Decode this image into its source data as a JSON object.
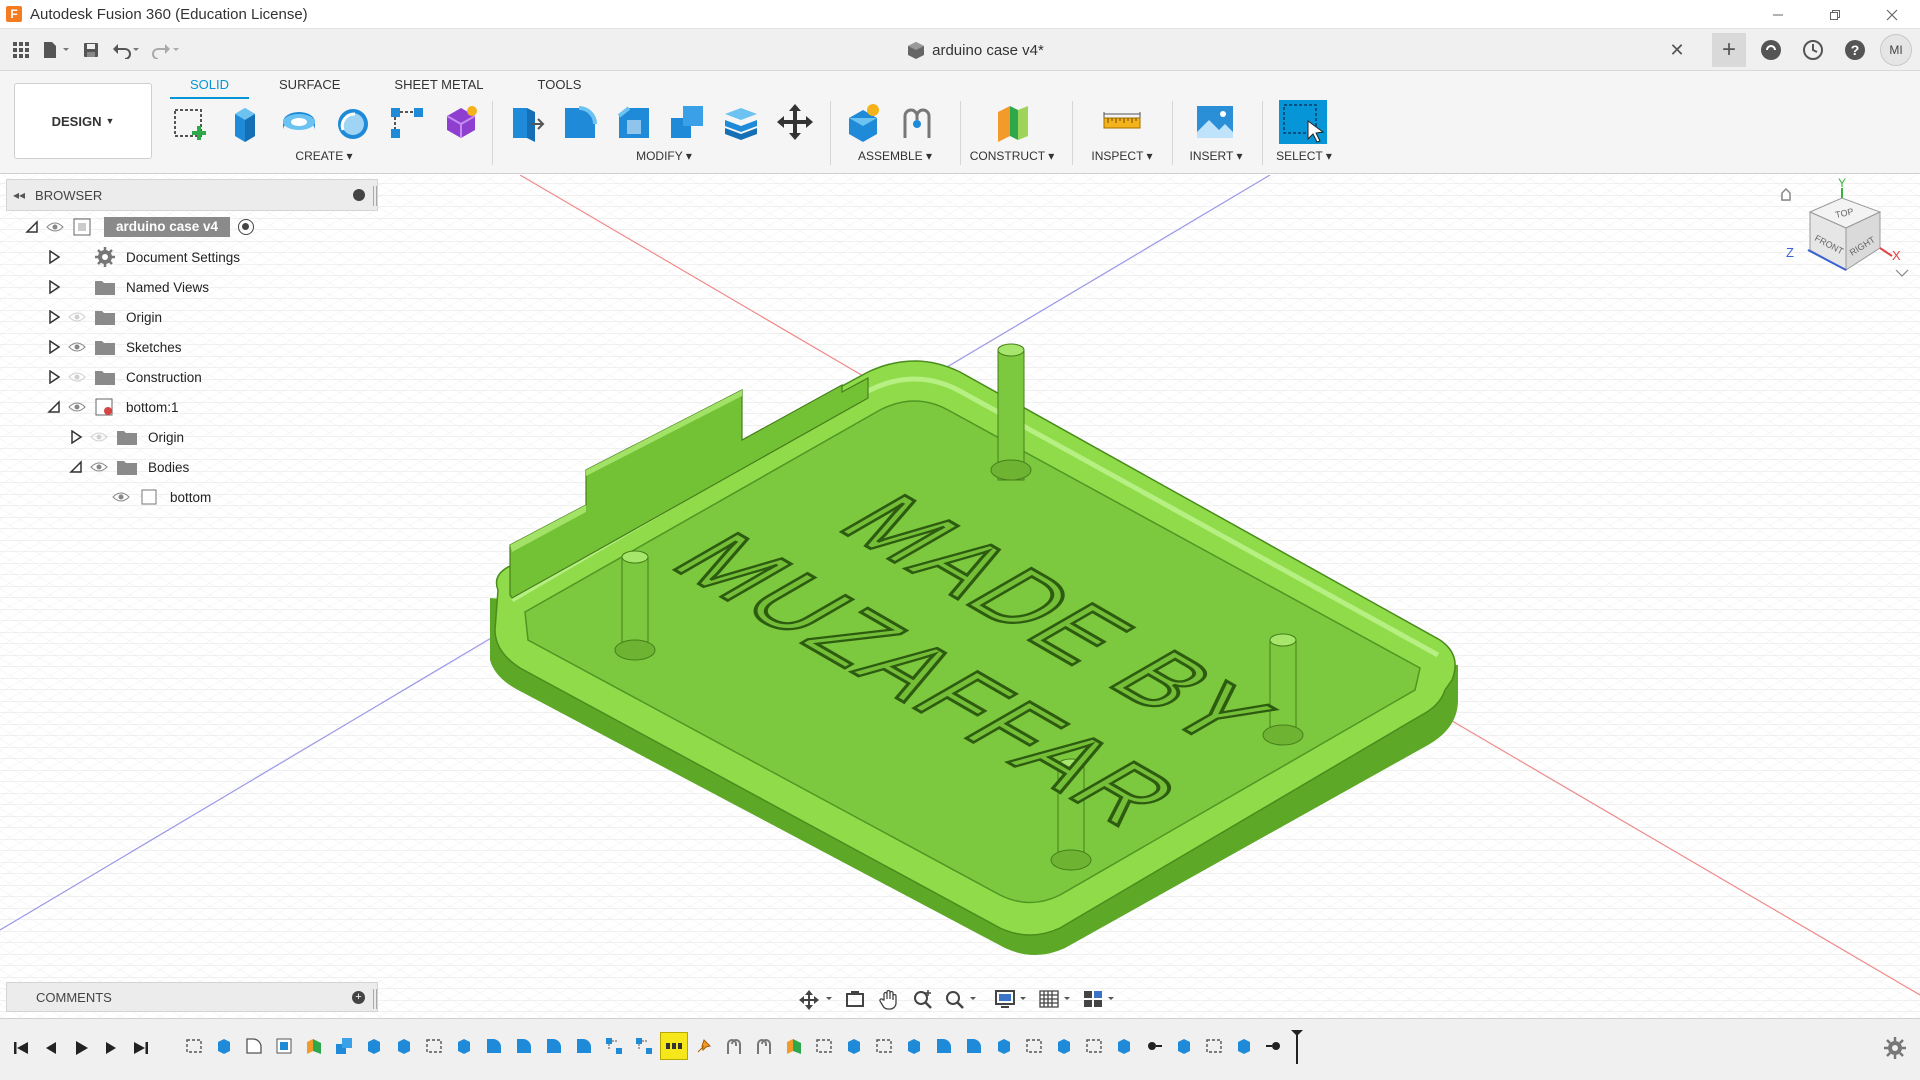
{
  "window": {
    "title": "Autodesk Fusion 360 (Education License)",
    "minimize_icon": "minimize-icon",
    "restore_icon": "restore-icon",
    "close_icon": "close-icon"
  },
  "tabbar": {
    "document_title": "arduino case v4*",
    "user_initials": "MI"
  },
  "toolbar": {
    "design_label": "DESIGN",
    "workspace_tabs": [
      "SOLID",
      "SURFACE",
      "SHEET METAL",
      "TOOLS"
    ],
    "active_tab": "SOLID",
    "groups": {
      "create": "CREATE",
      "modify": "MODIFY",
      "assemble": "ASSEMBLE",
      "construct": "CONSTRUCT",
      "inspect": "INSPECT",
      "insert": "INSERT",
      "select": "SELECT"
    }
  },
  "browser": {
    "title": "BROWSER",
    "items": [
      {
        "label": "arduino case v4",
        "level": 0,
        "expanded": true,
        "icon": "component-icon"
      },
      {
        "label": "Document Settings",
        "level": 1,
        "expanded": false,
        "icon": "gear-icon"
      },
      {
        "label": "Named Views",
        "level": 1,
        "expanded": false,
        "icon": "folder-icon"
      },
      {
        "label": "Origin",
        "level": 1,
        "expanded": false,
        "icon": "folder-icon"
      },
      {
        "label": "Sketches",
        "level": 1,
        "expanded": false,
        "icon": "folder-icon"
      },
      {
        "label": "Construction",
        "level": 1,
        "expanded": false,
        "icon": "folder-icon"
      },
      {
        "label": "bottom:1",
        "level": 1,
        "expanded": true,
        "icon": "component-icon"
      },
      {
        "label": "Origin",
        "level": 2,
        "expanded": false,
        "icon": "folder-icon"
      },
      {
        "label": "Bodies",
        "level": 2,
        "expanded": true,
        "icon": "folder-icon"
      },
      {
        "label": "bottom",
        "level": 3,
        "icon": "body-icon"
      }
    ]
  },
  "comments": {
    "title": "COMMENTS"
  },
  "model": {
    "engraved_text_line1": "MADE BY",
    "engraved_text_line2": "MUZAFFAR",
    "body_color": "#7ed13a"
  },
  "viewcube": {
    "top": "TOP",
    "front": "FRONT",
    "right": "RIGHT",
    "axis_x": "X",
    "axis_y": "Y",
    "axis_z": "Z"
  },
  "colors": {
    "accent": "#0696d7",
    "model_green": "#7ed13a",
    "timeline_selected": "#f6e71a"
  }
}
